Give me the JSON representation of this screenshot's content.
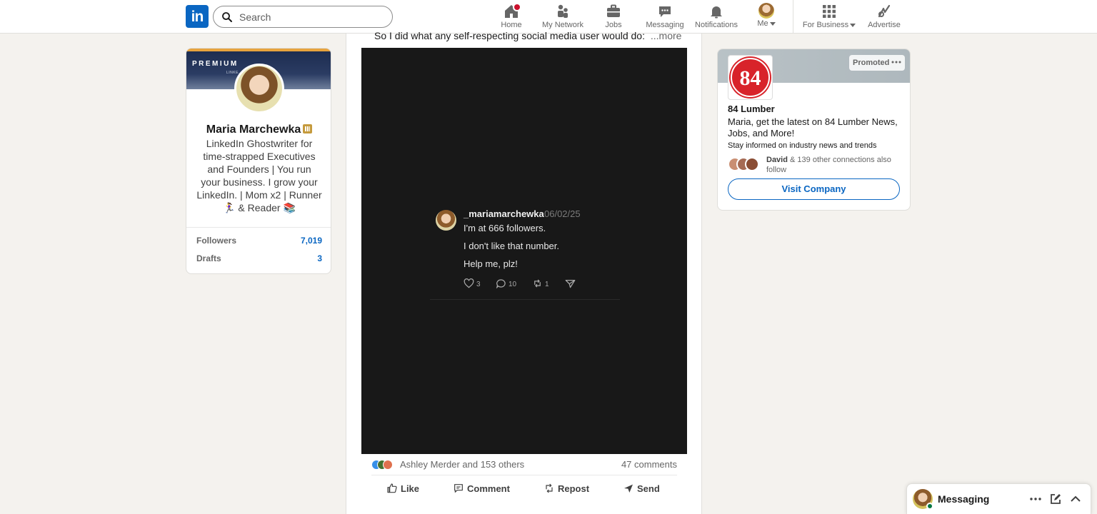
{
  "nav": {
    "search_placeholder": "Search",
    "items": [
      {
        "label": "Home",
        "icon": "home-icon"
      },
      {
        "label": "My Network",
        "icon": "people-icon"
      },
      {
        "label": "Jobs",
        "icon": "briefcase-icon"
      },
      {
        "label": "Messaging",
        "icon": "chat-icon"
      },
      {
        "label": "Notifications",
        "icon": "bell-icon"
      },
      {
        "label": "Me",
        "icon": "avatar"
      },
      {
        "label": "For Business",
        "icon": "grid-icon"
      },
      {
        "label": "Advertise",
        "icon": "compass-icon"
      }
    ],
    "logo_text": "in"
  },
  "profile": {
    "banner_label": "PREMIUM",
    "banner_text": "LINKE... ...QUIRES...",
    "name": "Maria Marchewka",
    "headline": "LinkedIn Ghostwriter for time-strapped Executives and Founders | You run your business. I grow your LinkedIn. | Mom x2 | Runner 🏃‍♀️ & Reader 📚",
    "stats": [
      {
        "label": "Followers",
        "value": "7,019"
      },
      {
        "label": "Drafts",
        "value": "3"
      }
    ]
  },
  "post": {
    "text": "So I did what any self-respecting social media user would do:",
    "more_label": "...more",
    "tweet": {
      "handle": "_mariamarchewka",
      "date": "06/02/25",
      "lines": [
        "I'm at 666 followers.",
        "I don't like that number.",
        "Help me, plz!"
      ],
      "likes": "3",
      "replies": "10",
      "reposts": "1"
    },
    "reactions_text": "Ashley Merder and 153 others",
    "comments_text": "47 comments",
    "actions": {
      "like": "Like",
      "comment": "Comment",
      "repost": "Repost",
      "send": "Send"
    }
  },
  "ad": {
    "promoted_label": "Promoted",
    "logo_text": "84",
    "company": "84 Lumber",
    "message": "Maria, get the latest on 84 Lumber News, Jobs, and More!",
    "subtext": "Stay informed on industry news and trends",
    "follow_name": "David",
    "follow_rest": " & 139 other connections also follow",
    "button": "Visit Company"
  },
  "messaging": {
    "title": "Messaging"
  },
  "colors": {
    "brand": "#0a66c2",
    "badge": "#cb112d",
    "ad_red": "#d8232a",
    "premium_gold": "#e7a33e"
  }
}
